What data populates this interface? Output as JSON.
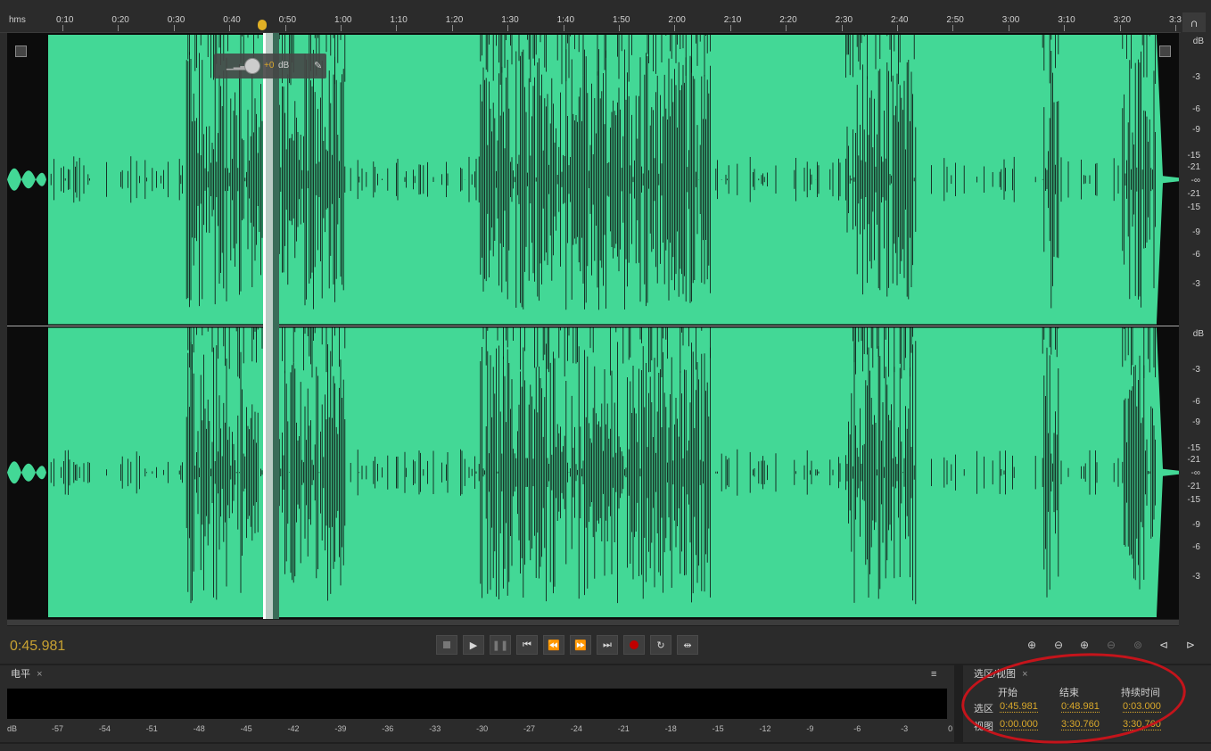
{
  "ruler": {
    "unit_label": "hms",
    "ticks": [
      "0:10",
      "0:20",
      "0:30",
      "0:40",
      "0:50",
      "1:00",
      "1:10",
      "1:20",
      "1:30",
      "1:40",
      "1:50",
      "2:00",
      "2:10",
      "2:20",
      "2:30",
      "2:40",
      "2:50",
      "3:00",
      "3:10",
      "3:20",
      "3:3"
    ]
  },
  "db_scale": {
    "unit": "dB",
    "labels": [
      "-3",
      "-6",
      "-9",
      "-15",
      "-21",
      "-∞",
      "-21",
      "-15",
      "-9",
      "-6",
      "-3"
    ]
  },
  "hud": {
    "gain_value": "+0",
    "gain_unit": "dB"
  },
  "transport": {
    "current_time": "0:45.981",
    "buttons": [
      "stop",
      "play",
      "pause",
      "go-to-start",
      "rewind",
      "fast-forward",
      "go-to-end",
      "record",
      "loop",
      "skip-selection"
    ]
  },
  "colors": {
    "waveform": "#43d896",
    "playhead": "#ffffff",
    "selection": "#3a6b58",
    "accent": "#d9a82b",
    "record": "#c00000",
    "annotation": "#c4141b"
  },
  "level_meter": {
    "tab_label": "电平",
    "scale": [
      "dB",
      "-57",
      "-54",
      "-51",
      "-48",
      "-45",
      "-42",
      "-39",
      "-36",
      "-33",
      "-30",
      "-27",
      "-24",
      "-21",
      "-18",
      "-15",
      "-12",
      "-9",
      "-6",
      "-3",
      "0"
    ]
  },
  "selection_view": {
    "tab_label": "选区/视图",
    "headers": {
      "start": "开始",
      "end": "结束",
      "duration": "持续时间"
    },
    "selection": {
      "label": "选区",
      "start": "0:45.981",
      "end": "0:48.981",
      "duration": "0:03.000"
    },
    "view": {
      "label": "视图",
      "start": "0:00.000",
      "end": "3:30.760",
      "duration": "3:30.760"
    }
  }
}
